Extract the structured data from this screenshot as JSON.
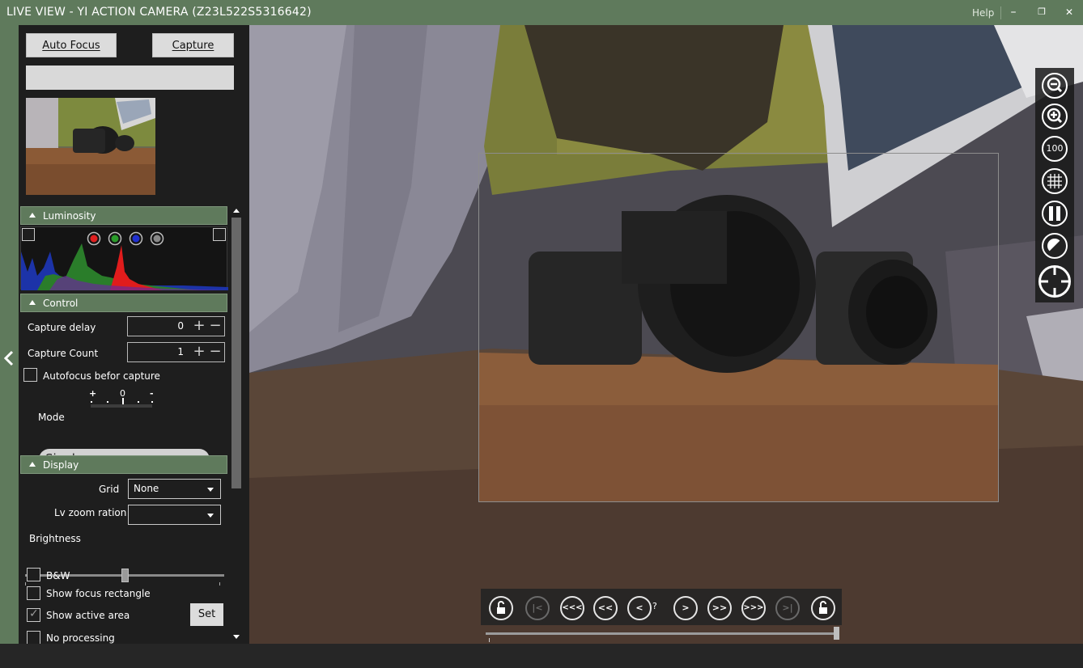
{
  "window": {
    "title": "LIVE VIEW - YI ACTION CAMERA (Z23L522S5316642)",
    "help": "Help",
    "minimize": "–",
    "maximize": "❐",
    "close": "✕"
  },
  "toolbar": {
    "autofocus_label": "Auto Focus",
    "capture_label": "Capture"
  },
  "luminosity": {
    "title": "Luminosity",
    "channels": [
      "red",
      "green",
      "blue",
      "gray"
    ]
  },
  "control": {
    "title": "Control",
    "capture_delay_label": "Capture delay",
    "capture_delay_value": "0",
    "capture_count_label": "Capture Count",
    "capture_count_value": "1",
    "autofocus_before_label": "Autofocus befor capture",
    "focus_scale": {
      "plus": "+",
      "zero": "0",
      "minus": "-"
    },
    "mode_label": "Mode",
    "mode_value": "Single"
  },
  "display": {
    "title": "Display",
    "grid_label": "Grid",
    "grid_value": "None",
    "lv_zoom_label": "Lv zoom ration",
    "lv_zoom_value": "",
    "brightness_label": "Brightness",
    "bw_label": "B&W",
    "show_focus_label": "Show focus rectangle",
    "show_active_label": "Show active area",
    "set_label": "Set",
    "no_processing_label": "No processing"
  },
  "right_tools": {
    "zoom_100_label": "100"
  },
  "navigation": {
    "first": "|<",
    "back_fast": "<<<",
    "back_medium": "<<",
    "back": "<",
    "position": "?",
    "forward": ">",
    "forward_medium": ">>",
    "forward_fast": ">>>",
    "last": ">|"
  },
  "colors": {
    "accent": "#5f7a5c",
    "panel_bg": "#1e1e1e",
    "button_bg": "#dcdcdc"
  }
}
